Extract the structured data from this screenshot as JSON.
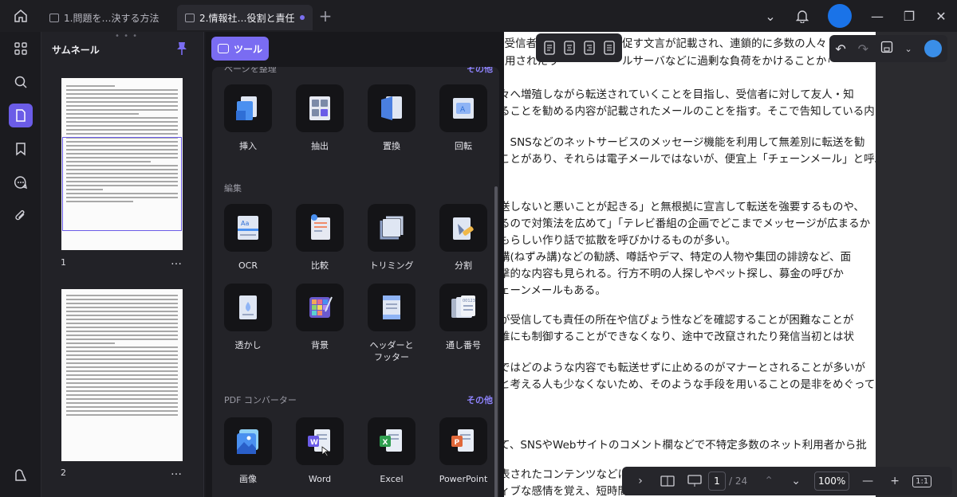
{
  "tabs": [
    {
      "label": "1.問題を…決する方法"
    },
    {
      "label": "2.情報社…役割と責任"
    }
  ],
  "tab_plus": "+",
  "thumbnails": {
    "title": "サムネール",
    "pages": [
      {
        "num": "1"
      },
      {
        "num": "2"
      }
    ],
    "more": "…"
  },
  "tools_button": "ツール",
  "tools": {
    "top_section_title": "ページを整理",
    "top_more": "その他",
    "page_tools": [
      {
        "label": "挿入",
        "icon": "insert-pages-icon"
      },
      {
        "label": "抽出",
        "icon": "extract-pages-icon"
      },
      {
        "label": "置換",
        "icon": "replace-pages-icon"
      },
      {
        "label": "回転",
        "icon": "rotate-pages-icon"
      }
    ],
    "edit_title": "編集",
    "edit_tools": [
      {
        "label": "OCR",
        "icon": "ocr-icon"
      },
      {
        "label": "比較",
        "icon": "compare-icon"
      },
      {
        "label": "トリミング",
        "icon": "crop-icon"
      },
      {
        "label": "分割",
        "icon": "split-icon"
      },
      {
        "label": "透かし",
        "icon": "watermark-icon"
      },
      {
        "label": "背景",
        "icon": "background-icon"
      },
      {
        "label": "ヘッダーと\nフッター",
        "icon": "header-footer-icon"
      },
      {
        "label": "通し番号",
        "icon": "bates-number-icon"
      }
    ],
    "converter_title": "PDF コンバーター",
    "converter_more": "その他",
    "converter_tools": [
      {
        "label": "画像",
        "icon": "image-convert-icon"
      },
      {
        "label": "Word",
        "icon": "word-convert-icon"
      },
      {
        "label": "Excel",
        "icon": "excel-convert-icon"
      },
      {
        "label": "PowerPoint",
        "icon": "powerpoint-convert-icon"
      }
    ]
  },
  "document": {
    "lines": [
      "電子メールにおける迷惑行為の一つで、受信者に",
      "覧されるメールのこと。流言の拡散に利用されたり",
      "々へ増殖しながら転送されていくことを目指し、受信者に対して友人・知",
      "ることを勧める内容が記載されたメールのことを指す。そこで告知している内",
      "、SNSなどのネットサービスのメッセージ機能を利用して無差別に転送を勧",
      "ことがあり、それらは電子メールではないが、便宜上「チェーンメール」と呼ぶ",
      "送しないと悪いことが起きる」と無根拠に宣言して転送を強要するものや、",
      "るので対策法を広めて」「テレビ番組の企画でどこまでメッセージが広まるか",
      "もらしい作り話で拡散を呼びかけるものが多い。",
      "講(ねずみ講)などの勧誘、噂話やデマ、特定の人物や集団の誹謗など、面",
      "撃的な内容も見られる。行方不明の人探しやペット探し、募金の呼びか",
      "ェーンメールもある。",
      "が受信しても責任の所在や信ぴょう性などを確認することが困難なことが",
      "誰にも制御することができなくなり、途中で改竄されたり発信当初とは状",
      "ではどのような内容でも転送せずに止めるのがマナーとされることが多いが",
      "と考える人も少なくないため、そのような手段を用いることの是非をめぐって",
      "て、SNSやWebサイトのコメント欄などで不特定多数のネット利用者から批",
      "表されたコンテンツなどに",
      "ィブな感情を覚え、短時間"
    ],
    "right_overflow_1": "促す文言が記載され、連鎖的に多数の人々",
    "right_overflow_2": "ルサーバなどに過剰な負荷をかけることから忌"
  },
  "bottom_bar": {
    "current_page": "1",
    "total_pages": "/ 24",
    "zoom": "100%",
    "fit_label": "1:1"
  },
  "colors": {
    "accent": "#7a6cf2",
    "panel_bg": "#232328",
    "tile_bg": "#141417"
  }
}
